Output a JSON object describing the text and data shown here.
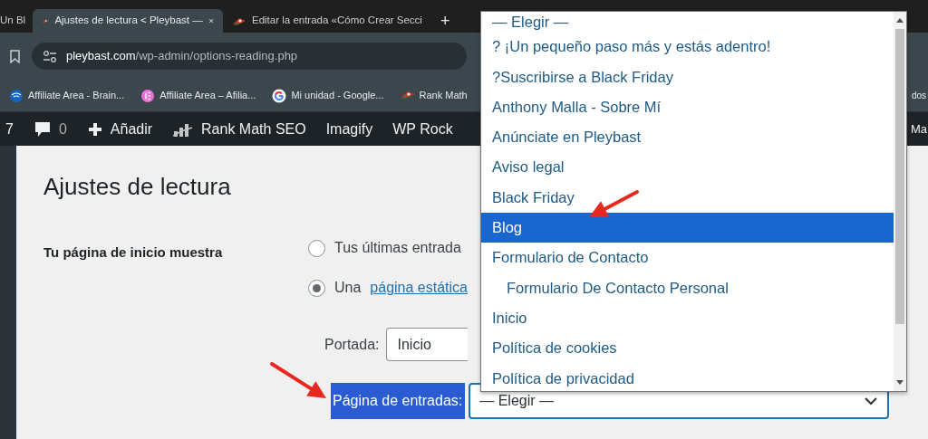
{
  "browser": {
    "tabs": [
      {
        "title": "Un Bl",
        "selected": false,
        "favicon": false
      },
      {
        "title": "Ajustes de lectura < Pleybast —",
        "selected": true,
        "favicon": true
      },
      {
        "title": "Editar la entrada «Cómo Crear Secci",
        "selected": false,
        "favicon": true
      }
    ],
    "new_tab": "+",
    "url_host": "pleybast.com",
    "url_path": "/wp-admin/options-reading.php",
    "bookmarks": [
      {
        "label": "Affiliate Area - Brain...",
        "kind": "signal"
      },
      {
        "label": "Affiliate Area – Afilia...",
        "kind": "elementor"
      },
      {
        "label": "Mi unidad - Google...",
        "kind": "google"
      },
      {
        "label": "Rank Math",
        "kind": "rankmath"
      }
    ],
    "bookmarks_overflow": "dos"
  },
  "admin_bar": {
    "updates": "7",
    "comments": "0",
    "items": [
      {
        "label": "Añadir",
        "kind": "plus"
      },
      {
        "label": "Rank Math SEO",
        "kind": "chart"
      },
      {
        "label": "Imagify",
        "kind": "text"
      },
      {
        "label": "WP Rock",
        "kind": "text"
      }
    ],
    "overflow": "Ma"
  },
  "page": {
    "title": "Ajustes de lectura",
    "front_label": "Tu página de inicio muestra",
    "options": [
      {
        "text": "Tus últimas entrada",
        "selected": false
      },
      {
        "text": "Una",
        "link": "página estática",
        "selected": true
      }
    ],
    "front_page_label": "Portada:",
    "front_page_value": "Inicio",
    "posts_page_label": "Página de entradas:",
    "posts_page_label_highlighted": true,
    "posts_page_value": "— Elegir —"
  },
  "dropdown": {
    "options": [
      {
        "label": "— Elegir —",
        "selected": false
      },
      {
        "label": "? ¡Un pequeño paso más y estás adentro!",
        "selected": false
      },
      {
        "label": "?Suscribirse a Black Friday",
        "selected": false
      },
      {
        "label": "Anthony Malla - Sobre Mí",
        "selected": false
      },
      {
        "label": "Anúnciate en Pleybast",
        "selected": false
      },
      {
        "label": "Aviso legal",
        "selected": false
      },
      {
        "label": "Black Friday",
        "selected": false
      },
      {
        "label": "Blog",
        "selected": true
      },
      {
        "label": "Formulario de Contacto",
        "selected": false,
        "children": [
          {
            "label": "Formulario De Contacto Personal",
            "selected": false
          }
        ]
      },
      {
        "label": "Inicio",
        "selected": false
      },
      {
        "label": "Política de cookies",
        "selected": false
      },
      {
        "label": "Política de privacidad",
        "selected": false
      }
    ]
  }
}
